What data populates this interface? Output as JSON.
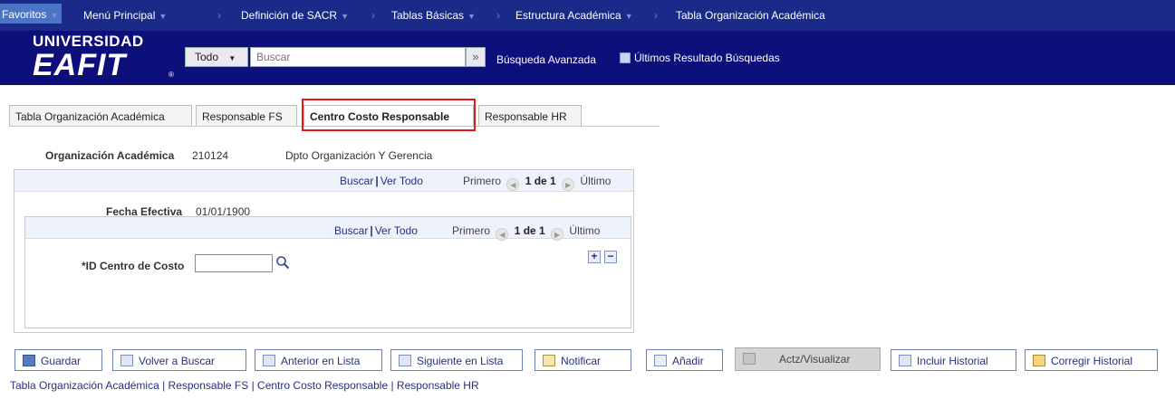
{
  "nav": {
    "favorites": "Favoritos",
    "main_menu": "Menú Principal",
    "crumbs": [
      "Definición de SACR",
      "Tablas Básicas",
      "Estructura Académica",
      "Tabla Organización Académica"
    ]
  },
  "logo": {
    "line1": "UNIVERSIDAD",
    "line2": "EAFIT"
  },
  "search": {
    "scope": "Todo",
    "placeholder": "Buscar",
    "advanced": "Búsqueda Avanzada",
    "recent": "Últimos Resultado Búsquedas"
  },
  "tabs": [
    "Tabla Organización Académica",
    "Responsable FS",
    "Centro Costo Responsable",
    "Responsable HR"
  ],
  "org": {
    "label": "Organización Académica",
    "code": "210124",
    "description": "Dpto Organización Y Gerencia"
  },
  "grid_outer": {
    "find": "Buscar",
    "view_all": "Ver Todo",
    "first": "Primero",
    "count": "1 de 1",
    "last": "Último"
  },
  "effective_date": {
    "label": "Fecha Efectiva",
    "value": "01/01/1900"
  },
  "grid_inner": {
    "find": "Buscar",
    "view_all": "Ver Todo",
    "first": "Primero",
    "count": "1 de 1",
    "last": "Último"
  },
  "cost_center": {
    "label": "*ID Centro de Costo",
    "value": ""
  },
  "toolbar": {
    "save": "Guardar",
    "return": "Volver a Buscar",
    "previous": "Anterior en Lista",
    "next": "Siguiente en Lista",
    "notify": "Notificar",
    "add": "Añadir",
    "update": "Actz/Visualizar",
    "include_history": "Incluir Historial",
    "correct_history": "Corregir Historial"
  },
  "footer": "Tabla Organización Académica | Responsable FS | Centro Costo Responsable | Responsable HR",
  "colors": {
    "header": "#0d0f7a",
    "nav": "#1a2a88",
    "highlight": "#e01818",
    "link": "#26307e"
  }
}
